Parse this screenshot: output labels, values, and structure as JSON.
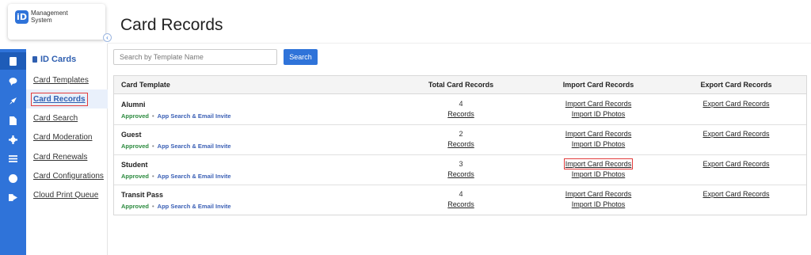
{
  "app": {
    "logo_mark": "iD",
    "logo_line1": "Management",
    "logo_line2": "System"
  },
  "rail": {
    "icons": [
      "id-card-icon",
      "chat-icon",
      "rocket-icon",
      "document-icon",
      "gear-icon",
      "list-icon",
      "help-icon",
      "logout-icon"
    ],
    "active_index": 0,
    "accent_color": "#2f73d9"
  },
  "subnav": {
    "title": "ID Cards",
    "items": [
      {
        "label": "Card Templates"
      },
      {
        "label": "Card Records",
        "active": true
      },
      {
        "label": "Card Search"
      },
      {
        "label": "Card Moderation"
      },
      {
        "label": "Card Renewals"
      },
      {
        "label": "Card Configurations"
      },
      {
        "label": "Cloud Print Queue"
      }
    ]
  },
  "page": {
    "title": "Card Records"
  },
  "search": {
    "placeholder": "Search by Template Name",
    "value": "",
    "button_label": "Search"
  },
  "table": {
    "headers": {
      "template": "Card Template",
      "total": "Total Card Records",
      "import": "Import Card Records",
      "export": "Export Card Records"
    },
    "rows": [
      {
        "name": "Alumni",
        "status": "Approved",
        "separator": "•",
        "invite": "App Search & Email Invite",
        "count": "4",
        "records_link": "Records",
        "import_link": "Import Card Records",
        "photos_link": "Import ID Photos",
        "export_link": "Export Card Records"
      },
      {
        "name": "Guest",
        "status": "Approved",
        "separator": "•",
        "invite": "App Search & Email Invite",
        "count": "2",
        "records_link": "Records",
        "import_link": "Import Card Records",
        "photos_link": "Import ID Photos",
        "export_link": "Export Card Records"
      },
      {
        "name": "Student",
        "status": "Approved",
        "separator": "•",
        "invite": "App Search & Email Invite",
        "count": "3",
        "records_link": "Records",
        "import_link": "Import Card Records",
        "photos_link": "Import ID Photos",
        "export_link": "Export Card Records"
      },
      {
        "name": "Transit Pass",
        "status": "Approved",
        "separator": "•",
        "invite": "App Search & Email Invite",
        "count": "4",
        "records_link": "Records",
        "import_link": "Import Card Records",
        "photos_link": "Import ID Photos",
        "export_link": "Export Card Records"
      }
    ]
  },
  "colors": {
    "status_approved": "#2b8a3e",
    "invite": "#3a5fb5",
    "highlight": "#e23c3c"
  }
}
